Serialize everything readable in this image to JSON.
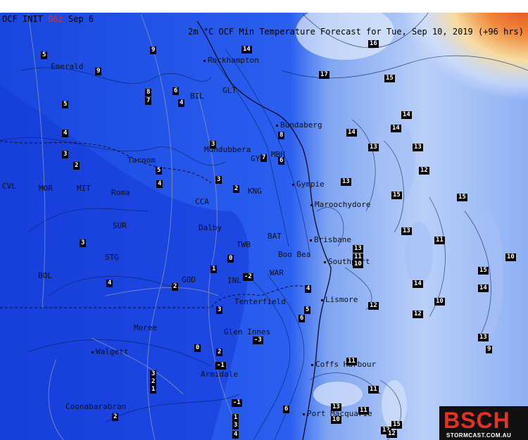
{
  "header": {
    "init_prefix": "OCF INIT ",
    "init_run": "06z",
    "init_date": " Sep 6",
    "title": "2m °C OCF Min Temperature Forecast for Tue, Sep 10, 2019 (+96 hrs)"
  },
  "colors": {
    "deep_blue": "#1a4fe6",
    "mid_blue": "#3c72f0",
    "light_blue": "#9ab8f5",
    "pale_blue": "#dbe6fb",
    "warm_yellow": "#f7dca0",
    "warm_orange": "#f08a3c",
    "hot_red": "#e0441c"
  },
  "cities": [
    {
      "name": "Emerald"
    },
    {
      "name": "Rockhampton"
    },
    {
      "name": "GLT"
    },
    {
      "name": "BIL"
    },
    {
      "name": "Bundaberg"
    },
    {
      "name": "Mundubbera"
    },
    {
      "name": "GYN"
    },
    {
      "name": "MBH"
    },
    {
      "name": "Taroom"
    },
    {
      "name": "Gympie"
    },
    {
      "name": "CVL"
    },
    {
      "name": "MOR"
    },
    {
      "name": "MIT"
    },
    {
      "name": "Roma"
    },
    {
      "name": "KNG"
    },
    {
      "name": "CCA"
    },
    {
      "name": "Maroochydore"
    },
    {
      "name": "SUR"
    },
    {
      "name": "Dalby"
    },
    {
      "name": "BAT"
    },
    {
      "name": "Brisbane"
    },
    {
      "name": "TWB"
    },
    {
      "name": "Boo Bea"
    },
    {
      "name": "STG"
    },
    {
      "name": "Southport"
    },
    {
      "name": "BOL"
    },
    {
      "name": "GOD"
    },
    {
      "name": "INL"
    },
    {
      "name": "WAR"
    },
    {
      "name": "Tenterfield"
    },
    {
      "name": "Lismore"
    },
    {
      "name": "Moree"
    },
    {
      "name": "Glen Innes"
    },
    {
      "name": "Walgett"
    },
    {
      "name": "Armidale"
    },
    {
      "name": "Coffs Harbour"
    },
    {
      "name": "Coonabarabran"
    },
    {
      "name": "Port Macquarie"
    }
  ],
  "values": [
    {
      "v": "5"
    },
    {
      "v": "9"
    },
    {
      "v": "9"
    },
    {
      "v": "14"
    },
    {
      "v": "16"
    },
    {
      "v": "17"
    },
    {
      "v": "15"
    },
    {
      "v": "8"
    },
    {
      "v": "7"
    },
    {
      "v": "6"
    },
    {
      "v": "4"
    },
    {
      "v": "5"
    },
    {
      "v": "4"
    },
    {
      "v": "3"
    },
    {
      "v": "2"
    },
    {
      "v": "5"
    },
    {
      "v": "4"
    },
    {
      "v": "3"
    },
    {
      "v": "8"
    },
    {
      "v": "7"
    },
    {
      "v": "6"
    },
    {
      "v": "14"
    },
    {
      "v": "14"
    },
    {
      "v": "14"
    },
    {
      "v": "13"
    },
    {
      "v": "13"
    },
    {
      "v": "12"
    },
    {
      "v": "13"
    },
    {
      "v": "15"
    },
    {
      "v": "15"
    },
    {
      "v": "3"
    },
    {
      "v": "2"
    },
    {
      "v": "3"
    },
    {
      "v": "13"
    },
    {
      "v": "11"
    },
    {
      "v": "13"
    },
    {
      "v": "11"
    },
    {
      "v": "10"
    },
    {
      "v": "10"
    },
    {
      "v": "1"
    },
    {
      "v": "0"
    },
    {
      "v": "-2"
    },
    {
      "v": "2"
    },
    {
      "v": "4"
    },
    {
      "v": "4"
    },
    {
      "v": "14"
    },
    {
      "v": "15"
    },
    {
      "v": "14"
    },
    {
      "v": "12"
    },
    {
      "v": "10"
    },
    {
      "v": "12"
    },
    {
      "v": "5"
    },
    {
      "v": "6"
    },
    {
      "v": "3"
    },
    {
      "v": "-3"
    },
    {
      "v": "0"
    },
    {
      "v": "2"
    },
    {
      "v": "-1"
    },
    {
      "v": "13"
    },
    {
      "v": "9"
    },
    {
      "v": "3"
    },
    {
      "v": "2"
    },
    {
      "v": "1"
    },
    {
      "v": "11"
    },
    {
      "v": "11"
    },
    {
      "v": "2"
    },
    {
      "v": "-1"
    },
    {
      "v": "6"
    },
    {
      "v": "13"
    },
    {
      "v": "10"
    },
    {
      "v": "11"
    },
    {
      "v": "12"
    },
    {
      "v": "15"
    },
    {
      "v": "12"
    },
    {
      "v": "1"
    },
    {
      "v": "3"
    },
    {
      "v": "4"
    }
  ],
  "logo": {
    "brand": "BSCH",
    "site": "STORMCAST.COM.AU"
  }
}
